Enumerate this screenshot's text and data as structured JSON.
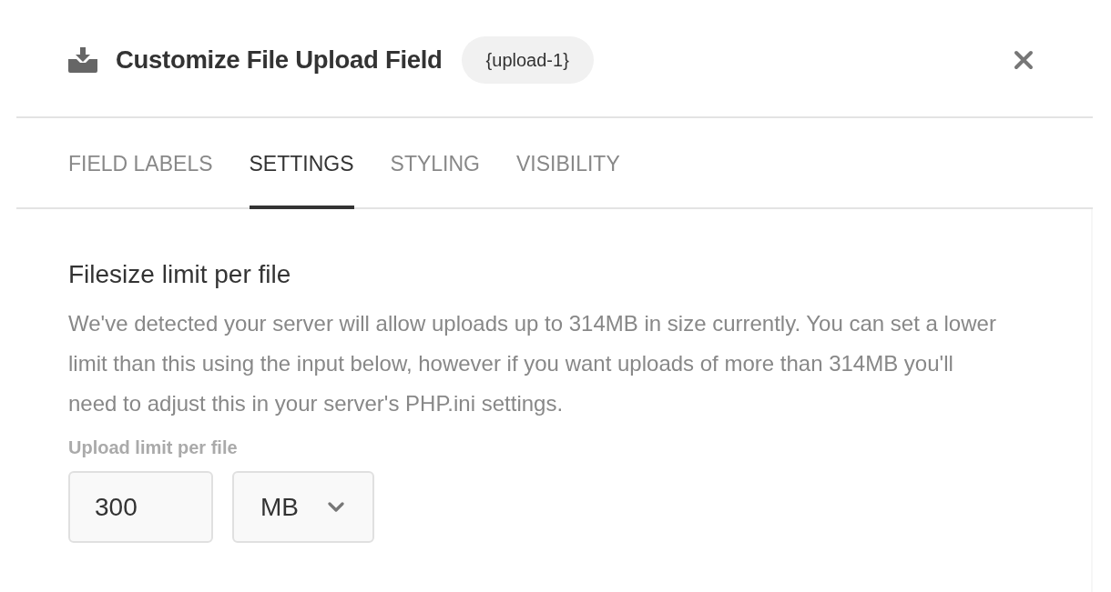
{
  "dialog": {
    "title": "Customize File Upload Field",
    "field_tag": "{upload-1}"
  },
  "tabs": [
    {
      "label": "FIELD LABELS",
      "selected": false
    },
    {
      "label": "SETTINGS",
      "selected": true
    },
    {
      "label": "STYLING",
      "selected": false
    },
    {
      "label": "VISIBILITY",
      "selected": false
    }
  ],
  "section": {
    "heading": "Filesize limit per file",
    "description": "We've detected your server will allow uploads up to 314MB in size currently. You can set a lower limit than this using the input below, however if you want uploads of more than 314MB you'll need to adjust this in your server's PHP.ini settings.",
    "field": {
      "label": "Upload limit per file",
      "value": "300",
      "unit": "MB"
    }
  }
}
